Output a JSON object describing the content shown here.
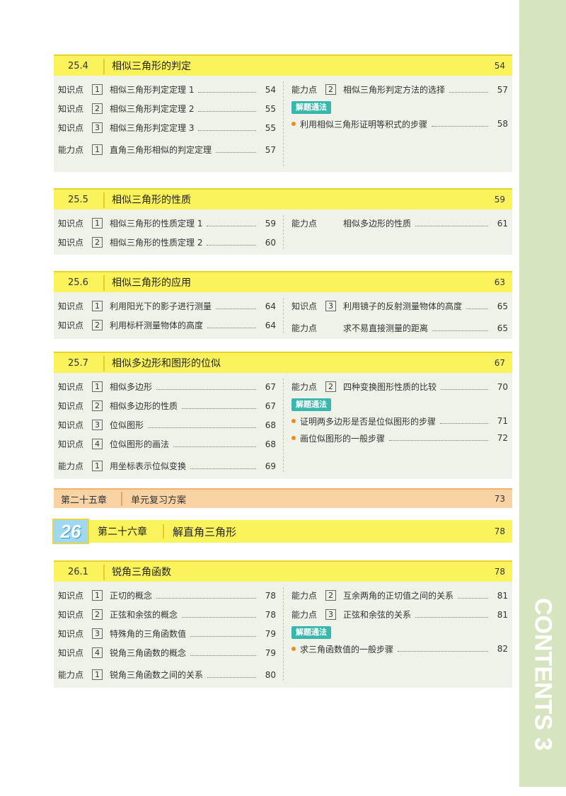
{
  "side": {
    "word": "CONTENTS",
    "page_number": "3"
  },
  "sections": [
    {
      "num": "25.4",
      "title": "相似三角形的判定",
      "page": "54",
      "left": [
        {
          "kind": "知识点",
          "n": "1",
          "label": "相似三角形判定定理 1",
          "page": "54"
        },
        {
          "kind": "知识点",
          "n": "2",
          "label": "相似三角形判定定理 2",
          "page": "55"
        },
        {
          "kind": "知识点",
          "n": "3",
          "label": "相似三角形判定定理 3",
          "page": "55"
        },
        {
          "kind": "能力点",
          "n": "1",
          "label": "直角三角形相似的判定定理",
          "page": "57"
        }
      ],
      "right": [
        {
          "kind": "能力点",
          "n": "2",
          "label": "相似三角形判定方法的选择",
          "page": "57"
        }
      ],
      "method_tag": "解题通法",
      "methods": [
        {
          "label": "利用相似三角形证明等积式的步骤",
          "page": "58"
        }
      ]
    },
    {
      "num": "25.5",
      "title": "相似三角形的性质",
      "page": "59",
      "left": [
        {
          "kind": "知识点",
          "n": "1",
          "label": "相似三角形的性质定理 1",
          "page": "59"
        },
        {
          "kind": "知识点",
          "n": "2",
          "label": "相似三角形的性质定理 2",
          "page": "60"
        }
      ],
      "right": [
        {
          "kind": "能力点",
          "n": "",
          "label": "相似多边形的性质",
          "page": "61"
        }
      ]
    },
    {
      "num": "25.6",
      "title": "相似三角形的应用",
      "page": "63",
      "left": [
        {
          "kind": "知识点",
          "n": "1",
          "label": "利用阳光下的影子进行测量",
          "page": "64"
        },
        {
          "kind": "知识点",
          "n": "2",
          "label": "利用标杆测量物体的高度",
          "page": "64"
        }
      ],
      "right": [
        {
          "kind": "知识点",
          "n": "3",
          "label": "利用镜子的反射测量物体的高度",
          "page": "65"
        },
        {
          "kind": "能力点",
          "n": "",
          "label": "求不易直接测量的距离",
          "page": "65"
        }
      ]
    },
    {
      "num": "25.7",
      "title": "相似多边形和图形的位似",
      "page": "67",
      "left": [
        {
          "kind": "知识点",
          "n": "1",
          "label": "相似多边形",
          "page": "67"
        },
        {
          "kind": "知识点",
          "n": "2",
          "label": "相似多边形的性质",
          "page": "67"
        },
        {
          "kind": "知识点",
          "n": "3",
          "label": "位似图形",
          "page": "68"
        },
        {
          "kind": "知识点",
          "n": "4",
          "label": "位似图形的画法",
          "page": "68"
        },
        {
          "kind": "能力点",
          "n": "1",
          "label": "用坐标表示位似变换",
          "page": "69"
        }
      ],
      "right": [
        {
          "kind": "能力点",
          "n": "2",
          "label": "四种变换图形性质的比较",
          "page": "70"
        }
      ],
      "method_tag": "解题通法",
      "methods": [
        {
          "label": "证明两多边形是否是位似图形的步骤",
          "page": "71"
        },
        {
          "label": "画位似图形的一般步骤",
          "page": "72"
        }
      ]
    }
  ],
  "review": {
    "chapter": "第二十五章",
    "title": "单元复习方案",
    "page": "73"
  },
  "chapter": {
    "badge": "26",
    "label": "第二十六章",
    "title": "解直角三角形",
    "page": "78"
  },
  "section_261": {
    "num": "26.1",
    "title": "锐角三角函数",
    "page": "78",
    "left": [
      {
        "kind": "知识点",
        "n": "1",
        "label": "正切的概念",
        "page": "78"
      },
      {
        "kind": "知识点",
        "n": "2",
        "label": "正弦和余弦的概念",
        "page": "78"
      },
      {
        "kind": "知识点",
        "n": "3",
        "label": "特殊角的三角函数值",
        "page": "79"
      },
      {
        "kind": "知识点",
        "n": "4",
        "label": "锐角三角函数的概念",
        "page": "79"
      },
      {
        "kind": "能力点",
        "n": "1",
        "label": "锐角三角函数之间的关系",
        "page": "80"
      }
    ],
    "right": [
      {
        "kind": "能力点",
        "n": "2",
        "label": "互余两角的正切值之间的关系",
        "page": "81"
      },
      {
        "kind": "能力点",
        "n": "3",
        "label": "正弦和余弦的关系",
        "page": "81"
      }
    ],
    "method_tag": "解题通法",
    "methods": [
      {
        "label": "求三角函数值的一般步骤",
        "page": "82"
      }
    ]
  }
}
